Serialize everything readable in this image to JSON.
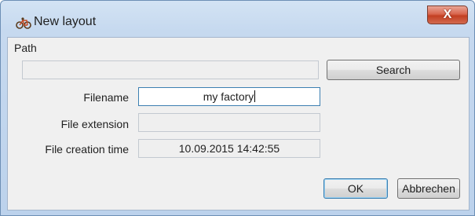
{
  "window": {
    "title": "New layout",
    "icon": "bicycle-icon",
    "close_glyph": "X"
  },
  "form": {
    "path_label": "Path",
    "path_value": "",
    "search_label": "Search",
    "filename_label": "Filename",
    "filename_value": "my factory",
    "extension_label": "File extension",
    "extension_value": "",
    "creation_time_label": "File creation time",
    "creation_time_value": "10.09.2015 14:42:55"
  },
  "buttons": {
    "ok_label": "OK",
    "cancel_label": "Abbrechen"
  },
  "colors": {
    "title_bar": "#c6d9ef",
    "close_button": "#c94a2e",
    "focus_border": "#3c7fb1"
  }
}
